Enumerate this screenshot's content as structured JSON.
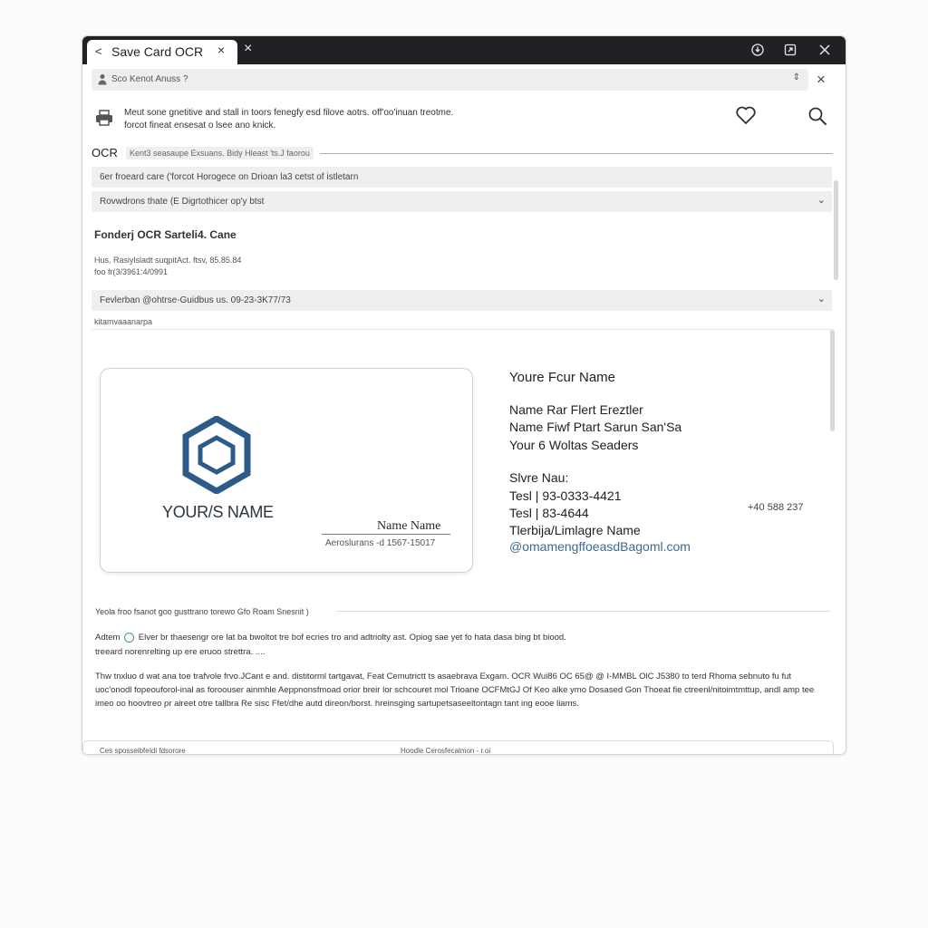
{
  "browser": {
    "back_glyph": "<",
    "tab_title": "Save Card OCR",
    "tab_close": "×",
    "new_tab": "×",
    "address_text": "Sco Kenot Anuss ?",
    "address_arrows": "⇕",
    "panel_close": "×"
  },
  "header": {
    "description_line1": "Meut sone gnetitive and stall in toors fenegfy esd filove aotrs. off'oo'inuan treotme.",
    "description_line2": "forcot fineat ensesat o lsee ano knick."
  },
  "ocr": {
    "label": "OCR",
    "chip_text": "Kent3 seasaupe   Exsuans. Bidy Hleast 'ts.J faorou"
  },
  "fields": {
    "bar1": "6er froeard care ('forcot   Horogece on Drioan la3 cetst of istletarn",
    "bar2": "Rovwdrons thate (E Digrtothicer op'y btst",
    "section_title": "Fonderj OCR Sarteli4. Cane",
    "section_line1": "Hus, Rasiylsladt suqpitAct. ftsv, 85.85.84",
    "section_line2": "foo fr(3/3961:4/0991",
    "bar3": "Fevlerban @ohtrse-Guidbus  us. 09-23-3K77/73",
    "subcaption": "kitamvaaanarpa"
  },
  "card": {
    "brand_name": "YOUR/S NAME",
    "signature_name": "Name Name",
    "signature_sub": "Aeroslurans -d 1567-15017"
  },
  "extracted": {
    "heading": "Youre Fcur Name",
    "line1": "Name Rar Flert Ereztler",
    "line2": "Name Fiwf Ptart Sarun San'Sa",
    "line3": "Your 6 Woltas Seaders",
    "line4": "Slvre Nau:",
    "line5": "Tesl | 93-0333-4421",
    "line6": "Tesl | 83-4644",
    "line7": "Tlerbija/Limlagre Name",
    "email": "@omamengffoeasdBagoml.com",
    "right_phone": "+40 588 237"
  },
  "info": {
    "heading": "Yeola froo fsanot goo gusttrano torewo Gfo Roam Snesnit )",
    "p1a": "Adtem",
    "p1b": "Elver br thaesengr ore lat ba bwoltot tre bof ecries tro and adtriolty ast. Opiog sae yet fo hata dasa bing bt biood.",
    "p1c": "treeard norenrelting up ere eruoo strettra. ....",
    "p2": "Thw tnxluo d wat ana toe trafvole frvo.JCant e and. distitorml tartgavat, Feat Cemutrictt ts asaebrava Exgam. OCR Wui86 OC 65@ @ I-MMBL OlC J5380 to terd Rhoma sebnuto fu fut uoc'onodl fopeouforol-inal as foroouser ainmhle Aeppnonsfmoad orior breir lor schcouret mol Trioane OCFMtGJ Of Keo alke ymo Dosased Gon Thoeat fie ctreenl/nitoimtmttup, andl amp tee imeo oo hoovtreo pr aireet otre tallbra Re sisc Ffet/dhe autd direon/borst. hreinsging sartupetsaseeltontagn tant ing eooe liams."
  },
  "bottom_panel": {
    "left_text": "Ces sposseibfeIdi fdsorore",
    "mid_text": "Hoodle   Cerosfecalmon   -   r.oi"
  },
  "colors": {
    "titlebar": "#202124",
    "logo_blue": "#2c5b8a",
    "ocr_divider": "#9bb3c7",
    "email_link": "#3c6a8f"
  },
  "icons": {
    "user": "user-icon",
    "printer": "printer-icon",
    "heart": "heart-icon",
    "search": "search-icon",
    "chevron": "chevron-down-icon",
    "window_controls": [
      "download-icon",
      "share-icon",
      "close-icon"
    ]
  }
}
